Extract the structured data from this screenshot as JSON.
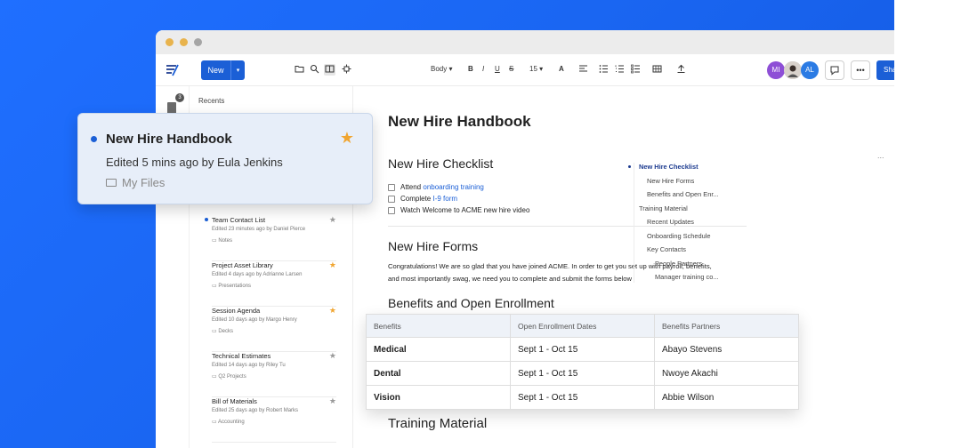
{
  "toolbar": {
    "new_label": "New",
    "font_style": "Body",
    "font_size": "15",
    "avatars": [
      {
        "initials": "MI",
        "color": "#8e4fd6"
      },
      {
        "initials": "",
        "color": "#c2c2c2"
      },
      {
        "initials": "AL",
        "color": "#2b7be4"
      }
    ],
    "share_label": "Sha"
  },
  "rail": {
    "badge_count": "3"
  },
  "sidebar": {
    "recents_label": "Recents",
    "files": [
      {
        "title": "Team Contact List",
        "meta": "Edited 23 minutes ago by Daniel Pierce",
        "folder": "Notes",
        "starred": false,
        "active": true
      },
      {
        "title": "Project Asset Library",
        "meta": "Edited 4 days ago by Adrianne Larsen",
        "folder": "Presentations",
        "starred": true,
        "active": false
      },
      {
        "title": "Session Agenda",
        "meta": "Edited 10 days ago by Margo Henry",
        "folder": "Decks",
        "starred": true,
        "active": false
      },
      {
        "title": "Technical Estimates",
        "meta": "Edited 14 days ago by Riley Tu",
        "folder": "Q2 Projects",
        "starred": false,
        "active": false
      },
      {
        "title": "Bill of Materials",
        "meta": "Edited 25 days ago by Robert Marks",
        "folder": "Accounting",
        "starred": false,
        "active": false
      }
    ]
  },
  "floating_card": {
    "title": "New Hire Handbook",
    "meta": "Edited 5 mins ago by Eula Jenkins",
    "folder": "My Files"
  },
  "document": {
    "title": "New Hire Handbook",
    "checklist_heading": "New Hire Checklist",
    "checklist": [
      {
        "pre": "Attend ",
        "link": "onboarding training",
        "post": ""
      },
      {
        "pre": "Complete ",
        "link": "I-9 form",
        "post": ""
      },
      {
        "pre": "Watch Welcome to ACME new hire video",
        "link": "",
        "post": ""
      }
    ],
    "forms_heading": "New Hire Forms",
    "forms_line1": "Congratulations! We are so glad that you have joined ACME. In order to get you set up with payroll, benefits,",
    "forms_line2": "and most importantly swag, we need you to complete and submit the forms below",
    "benefits_heading": "Benefits and Open Enrollment",
    "training_heading": "Training Material"
  },
  "benefits_table": {
    "headers": [
      "Benefits",
      "Open Enrollment Dates",
      "Benefits Partners"
    ],
    "rows": [
      [
        "Medical",
        "Sept 1 - Oct 15",
        "Abayo Stevens"
      ],
      [
        "Dental",
        "Sept 1 - Oct 15",
        "Nwoye Akachi"
      ],
      [
        "Vision",
        "Sept 1 - Oct 15",
        "Abbie Wilson"
      ]
    ]
  },
  "toc": {
    "more": "...",
    "items": [
      {
        "label": "New Hire Checklist",
        "level": 1,
        "active": true
      },
      {
        "label": "New Hire Forms",
        "level": 2,
        "active": false
      },
      {
        "label": "Benefits and Open Enr...",
        "level": 2,
        "active": false
      },
      {
        "label": "Training Material",
        "level": 1,
        "active": false
      },
      {
        "label": "Recent Updates",
        "level": 2,
        "active": false
      },
      {
        "label": "Onboarding Schedule",
        "level": 2,
        "active": false
      },
      {
        "label": "Key Contacts",
        "level": 2,
        "active": false
      },
      {
        "label": "People Partners",
        "level": 3,
        "active": false
      },
      {
        "label": "Manager training co...",
        "level": 3,
        "active": false
      }
    ]
  },
  "colors": {
    "accent": "#1b5fd6",
    "background_blue": "#1a66f2",
    "star": "#f0a531"
  }
}
